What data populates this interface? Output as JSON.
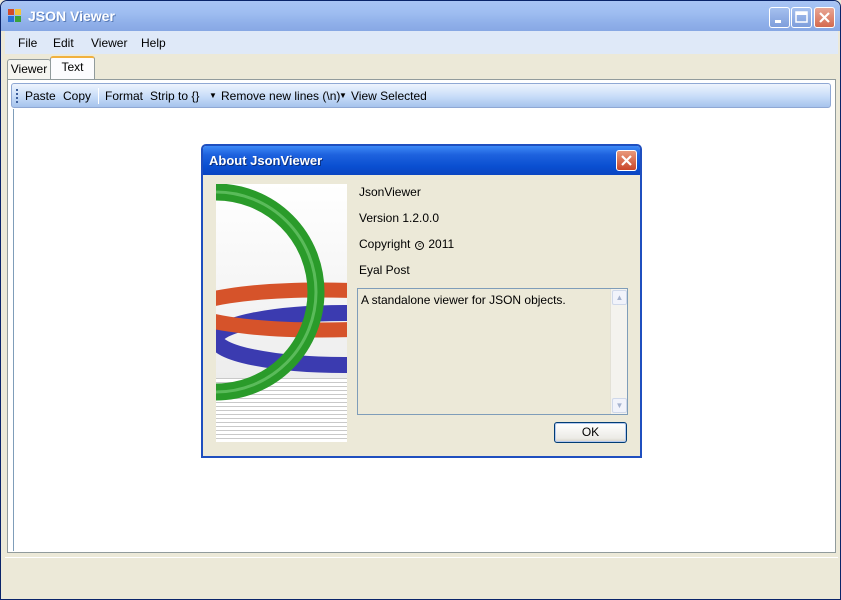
{
  "window": {
    "title": "JSON Viewer",
    "caption_buttons": {
      "minimize": "minimize-icon",
      "maximize": "maximize-icon",
      "close": "close-icon"
    }
  },
  "menu": {
    "items": [
      {
        "label": "File"
      },
      {
        "label": "Edit"
      },
      {
        "label": "Viewer"
      },
      {
        "label": "Help"
      }
    ]
  },
  "tabs": {
    "items": [
      {
        "label": "Viewer",
        "active": false
      },
      {
        "label": "Text",
        "active": true
      }
    ]
  },
  "toolbar": {
    "paste": "Paste",
    "copy": "Copy",
    "format": "Format",
    "strip": "Strip to {}",
    "remove_new_lines": "Remove new lines (\\n)",
    "view_selected": "View Selected"
  },
  "dialog": {
    "title": "About JsonViewer",
    "product": "JsonViewer",
    "version": "Version 1.2.0.0",
    "copyright_label": "Copyright",
    "copyright_year": "2011",
    "company": "Eyal Post",
    "description": "A standalone viewer for JSON objects.",
    "ok_label": "OK"
  },
  "colors": {
    "title_bar": "#9ebdf1",
    "dialog_title_bar": "#0a4fd1",
    "ring_green": "#2a9b2a",
    "ring_blue": "#3b3bb0",
    "ring_orange": "#d6532a",
    "active_tab_accent": "#f1b13d"
  }
}
